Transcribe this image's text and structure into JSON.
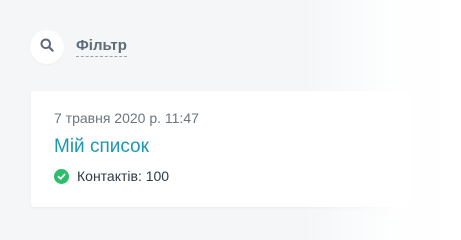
{
  "filter": {
    "icon": "search-icon",
    "label": "Фільтр"
  },
  "list_card": {
    "date": "7 травня 2020 р. 11:47",
    "title": "Мій список",
    "contacts_text": "Контактів: 100",
    "status_icon": "check-circle-icon",
    "colors": {
      "title": "#1b98b3",
      "status": "#2ebd6b"
    }
  }
}
